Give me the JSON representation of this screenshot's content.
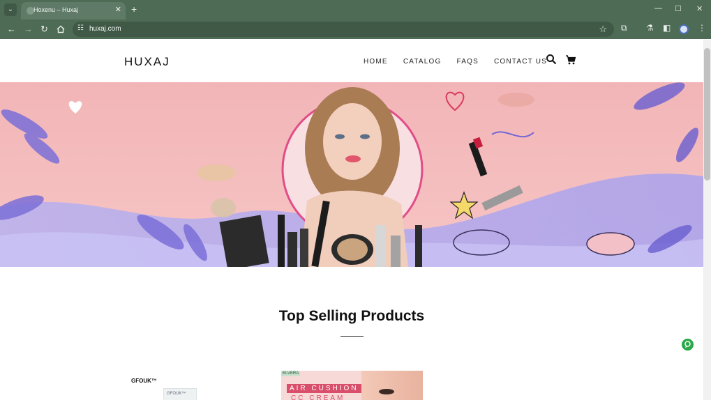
{
  "browser": {
    "tab_title": "Hoxenu – Huxaj",
    "tab_close": "✕",
    "new_tab": "+",
    "tab_menu": "⌄",
    "url": "huxaj.com",
    "window_controls": [
      "—",
      "☐",
      "✕"
    ],
    "icons": [
      "back-icon",
      "forward-icon",
      "reload-icon",
      "home-icon",
      "site-info-icon",
      "bookmark-star-icon",
      "extensions-icon",
      "labs-icon",
      "side-panel-icon",
      "profile-avatar",
      "more-menu-icon"
    ]
  },
  "site": {
    "logo": "HUXAJ",
    "nav": [
      "HOME",
      "CATALOG",
      "FAQS",
      "CONTACT US"
    ],
    "icons": [
      "search-icon",
      "cart-icon"
    ]
  },
  "hero": {
    "background": "#f4b6bb",
    "accent": "#8a7fe0"
  },
  "products": {
    "section_title": "Top Selling Products",
    "cards": [
      {
        "brand": "GFOUK™",
        "box_label": "GFOUK™"
      },
      {
        "brand": "ELVERA",
        "line1": "AIR CUSHION",
        "line2": "CC CREAM"
      }
    ]
  },
  "colors": {
    "chrome": "#4e6b55",
    "chat_button": "#2aa84a"
  }
}
